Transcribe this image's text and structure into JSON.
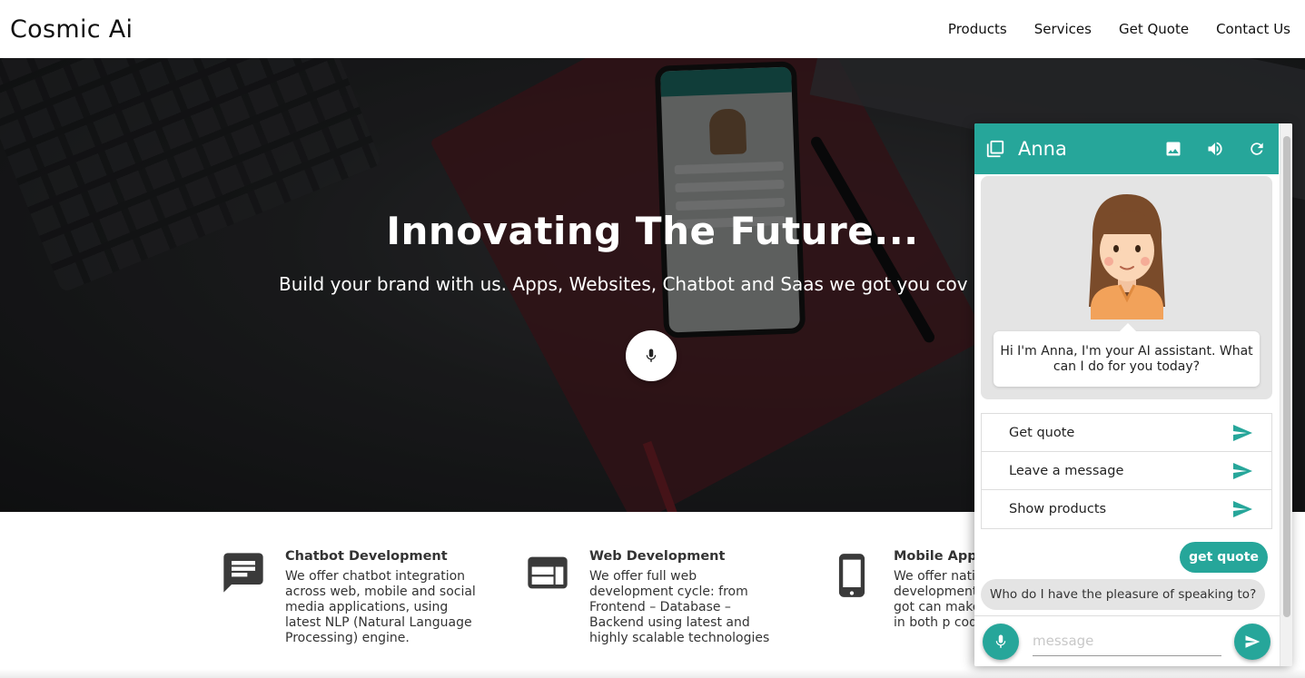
{
  "header": {
    "brand": "Cosmic Ai",
    "nav": [
      "Products",
      "Services",
      "Get Quote",
      "Contact Us"
    ]
  },
  "hero": {
    "title": "Innovating The Future...",
    "subtitle": "Build your brand with us. Apps, Websites, Chatbot and Saas we got you cov",
    "mic_icon": "microphone-icon"
  },
  "services": [
    {
      "icon": "chat-bubble-icon",
      "title": "Chatbot Development",
      "text": "We offer chatbot integration across web, mobile and social media applications, using latest NLP (Natural Language Processing) engine."
    },
    {
      "icon": "web-layout-icon",
      "title": "Web Development",
      "text": "We offer full web development cycle: from Frontend – Database – Backend using latest and highly scalable technologies"
    },
    {
      "icon": "smartphone-icon",
      "title": "Mobile App",
      "text": "We offer nati development IOS. You got can make hyl run in both p code base."
    }
  ],
  "chat": {
    "title": "Anna",
    "accent_color": "#26a69a",
    "header_icons": [
      "window-icon",
      "image-icon",
      "volume-icon",
      "refresh-icon"
    ],
    "greeting": "Hi I'm Anna, I'm your AI assistant. What can I do for you today?",
    "options": [
      "Get quote",
      "Leave a message",
      "Show products"
    ],
    "user_message": "get quote",
    "bot_message": "Who do I have the pleasure of speaking to?",
    "input_placeholder": "message"
  }
}
